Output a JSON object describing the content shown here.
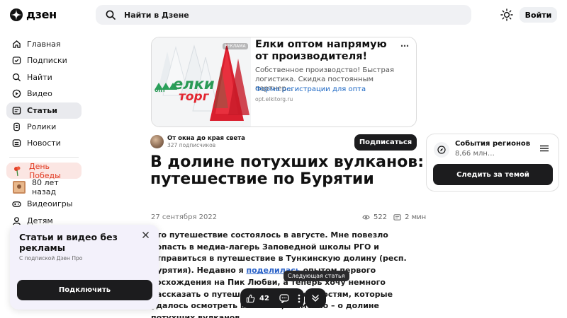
{
  "header": {
    "logo_text": "дзен",
    "search_placeholder": "Найти в Дзене",
    "login_label": "Войти"
  },
  "sidebar": {
    "items": [
      {
        "label": "Главная",
        "icon": "home-icon"
      },
      {
        "label": "Подписки",
        "icon": "subscriptions-icon"
      },
      {
        "label": "Найти",
        "icon": "search-icon"
      },
      {
        "label": "Видео",
        "icon": "video-icon"
      },
      {
        "label": "Статьи",
        "icon": "articles-icon",
        "active": true
      },
      {
        "label": "Ролики",
        "icon": "shorts-icon"
      },
      {
        "label": "Новости",
        "icon": "news-icon"
      }
    ],
    "extra": [
      {
        "label": "День Победы",
        "icon": "carnation-icon"
      },
      {
        "label": "80 лет назад",
        "icon": "archive-photo-icon"
      },
      {
        "label": "Видеоигры",
        "icon": "gamepad-icon"
      },
      {
        "label": "Детям",
        "icon": "kids-icon"
      }
    ]
  },
  "ad": {
    "title": "Елки оптом напрямую от производителя!",
    "description": "Собственное производство! Быстрая логистика. Скидка постоянным партнер…",
    "link": "Форма регистрации для опта",
    "domain": "opt.elkitorg.ru",
    "tag": "РЕКЛАМА",
    "brand_top": "елки",
    "brand_bottom": "торг",
    "brand_small": "опт",
    "more": "⋯"
  },
  "channel": {
    "name": "От окна до края света",
    "subscribers": "327 подписчиков",
    "subscribe_label": "Подписаться"
  },
  "article": {
    "title": "В долине потухших вулканов: путешествие по Бурятии",
    "date": "27 сентября 2022",
    "views": "522",
    "read_time": "2 мин",
    "body_1": "Это путешествие состоялось в августе. Мне повезло попасть в медиа-лагерь Заповедной школы РГО и отправиться в путешествие в Тункинскую долину (респ. Бурятия). Недавно я ",
    "body_link": "поделилась",
    "body_2": " опытом первого восхождения на Пик Любви, а теперь хочу немного рассказать о путешествии по окрестностям, которые удалось осмотреть в высоты, а именно – о долине потухших вулканов."
  },
  "region_widget": {
    "title": "События регионов",
    "subtitle": "8,66 млн…",
    "follow_label": "Следить за темой"
  },
  "promo": {
    "title": "Статьи и видео без рекламы",
    "subtitle": "С подпиской Дзен Про",
    "button_label": "Подключить"
  },
  "action_bar": {
    "likes": "42",
    "tooltip": "Следующая статья"
  },
  "colors": {
    "accent_dark": "#1c1c1e",
    "link_blue": "#1a66c4",
    "victory_red": "#e23c24"
  }
}
